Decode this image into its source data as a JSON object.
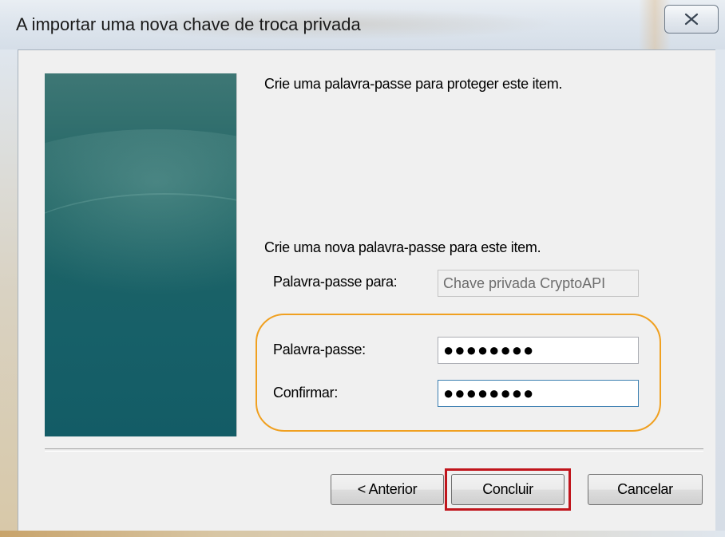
{
  "window": {
    "title": "A importar uma nova chave de troca privada",
    "close_icon": "close-x-icon"
  },
  "content": {
    "intro": "Crie uma palavra-passe para proteger este item.",
    "subintro": "Crie uma nova palavra-passe para este item.",
    "password_for_label": "Palavra-passe para:",
    "password_for_value": "Chave privada CryptoAPI",
    "password_label": "Palavra-passe:",
    "password_value": "●●●●●●●●",
    "confirm_label": "Confirmar:",
    "confirm_value": "●●●●●●●●"
  },
  "buttons": {
    "back": "< Anterior",
    "finish": "Concluir",
    "cancel": "Cancelar"
  },
  "colors": {
    "highlight_orange": "#f0a020",
    "highlight_red": "#c0151c",
    "banner_teal": "#1f6464"
  }
}
